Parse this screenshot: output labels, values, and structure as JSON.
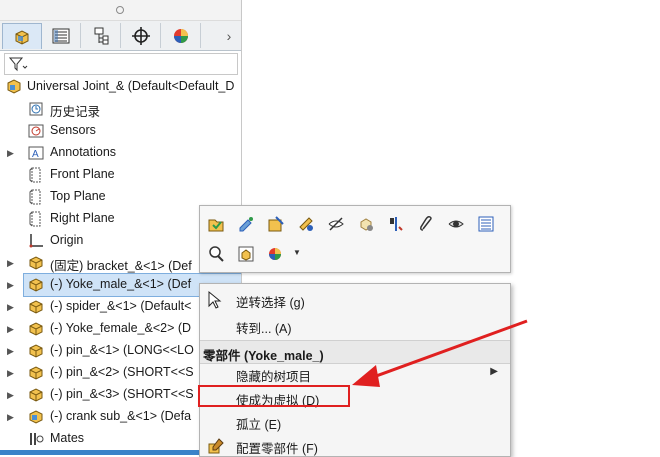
{
  "feature_tree": {
    "tabs": [
      {
        "icon": "feature-manager-icon",
        "active": true
      },
      {
        "icon": "property-manager-icon",
        "active": false
      },
      {
        "icon": "configuration-manager-icon",
        "active": false
      },
      {
        "icon": "dimxpert-icon",
        "active": false
      },
      {
        "icon": "display-manager-icon",
        "active": false
      }
    ],
    "more": "›",
    "filter_icon": "filter-icon",
    "root": "Universal Joint_&  (Default<Default_D",
    "items": [
      {
        "label": "历史记录",
        "icon": "history-icon",
        "expandable": false
      },
      {
        "label": "Sensors",
        "icon": "sensors-icon",
        "expandable": false
      },
      {
        "label": "Annotations",
        "icon": "annotations-icon",
        "expandable": true
      },
      {
        "label": "Front Plane",
        "icon": "plane-icon",
        "expandable": false
      },
      {
        "label": "Top Plane",
        "icon": "plane-icon",
        "expandable": false
      },
      {
        "label": "Right Plane",
        "icon": "plane-icon",
        "expandable": false
      },
      {
        "label": "Origin",
        "icon": "origin-icon",
        "expandable": false
      },
      {
        "label": "(固定) bracket_&<1> (Def",
        "icon": "part-icon",
        "expandable": true
      },
      {
        "label": "(-) Yoke_male_&<1> (Def",
        "icon": "part-icon",
        "expandable": true,
        "selected": true
      },
      {
        "label": "(-) spider_&<1> (Default<",
        "icon": "part-icon",
        "expandable": true
      },
      {
        "label": "(-) Yoke_female_&<2> (D",
        "icon": "part-icon",
        "expandable": true
      },
      {
        "label": "(-) pin_&<1> (LONG<<LO",
        "icon": "part-icon",
        "expandable": true
      },
      {
        "label": "(-) pin_&<2> (SHORT<<S",
        "icon": "part-icon",
        "expandable": true
      },
      {
        "label": "(-) pin_&<3> (SHORT<<S",
        "icon": "part-icon",
        "expandable": true
      },
      {
        "label": "(-) crank sub_&<1> (Defa",
        "icon": "subassembly-icon",
        "expandable": true
      },
      {
        "label": "Mates",
        "icon": "mates-icon",
        "expandable": false
      }
    ]
  },
  "context_toolbar": {
    "row1": [
      "open-part-icon",
      "edit-part-icon",
      "edit-assembly-icon",
      "appearance-icon",
      "hide-icon",
      "isolate-icon",
      "fix-float-icon",
      "paperclip-icon",
      "transparency-icon",
      "properties-icon"
    ],
    "row2": [
      "zoom-to-selection-icon",
      "component-properties-icon",
      "color-icon"
    ]
  },
  "context_menu": {
    "items_top": [
      {
        "label": "逆转选择 (g)",
        "icon": "invert-selection-icon"
      },
      {
        "label": "转到... (A)",
        "icon": ""
      }
    ],
    "header": "零部件 (Yoke_male_)",
    "items": [
      {
        "label": "隐藏的树项目",
        "has_submenu": true,
        "icon": ""
      },
      {
        "label": "使成为虚拟 (D)",
        "icon": ""
      },
      {
        "label": "孤立 (E)",
        "icon": ""
      },
      {
        "label": "配置零部件 (F)",
        "icon": "configure-component-icon"
      }
    ]
  },
  "annotation": {
    "color": "#e02020"
  }
}
